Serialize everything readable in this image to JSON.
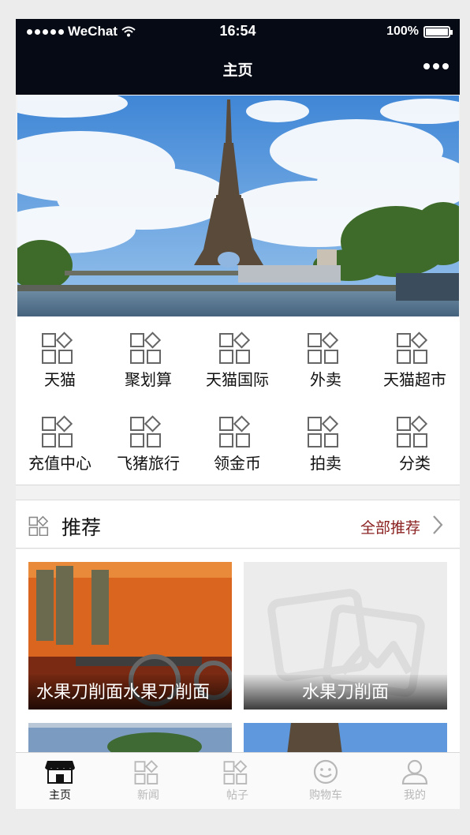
{
  "status_bar": {
    "carrier": "WeChat",
    "time": "16:54",
    "battery": "100%"
  },
  "nav": {
    "title": "主页"
  },
  "banner": {
    "slide_count": 4,
    "active_slide": 4
  },
  "grid": {
    "items": [
      {
        "label": "天猫",
        "icon": "grid-shape-icon"
      },
      {
        "label": "聚划算",
        "icon": "grid-shape-icon"
      },
      {
        "label": "天猫国际",
        "icon": "grid-shape-icon"
      },
      {
        "label": "外卖",
        "icon": "grid-shape-icon"
      },
      {
        "label": "天猫超市",
        "icon": "grid-shape-icon"
      },
      {
        "label": "充值中心",
        "icon": "grid-shape-icon"
      },
      {
        "label": "飞猪旅行",
        "icon": "grid-shape-icon"
      },
      {
        "label": "领金币",
        "icon": "grid-shape-icon"
      },
      {
        "label": "拍卖",
        "icon": "grid-shape-icon"
      },
      {
        "label": "分类",
        "icon": "grid-shape-icon"
      }
    ]
  },
  "recommend": {
    "title": "推荐",
    "more_label": "全部推荐"
  },
  "cards": [
    {
      "caption": "水果刀削面水果刀削面"
    },
    {
      "caption": "水果刀削面"
    }
  ],
  "tabbar": {
    "items": [
      {
        "label": "主页",
        "icon": "shop-icon",
        "active": true
      },
      {
        "label": "新闻",
        "icon": "grid-shape-icon",
        "active": false
      },
      {
        "label": "帖子",
        "icon": "grid-shape-icon",
        "active": false
      },
      {
        "label": "购物车",
        "icon": "smiley-icon",
        "active": false
      },
      {
        "label": "我的",
        "icon": "user-icon",
        "active": false
      }
    ]
  },
  "colors": {
    "nav_bg": "#050a14",
    "accent": "#8a1f1f",
    "inactive_tab": "#b8b8b8"
  }
}
